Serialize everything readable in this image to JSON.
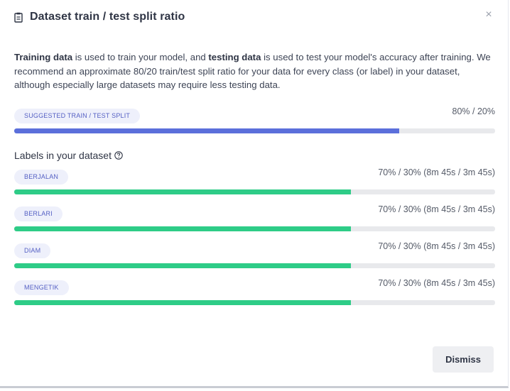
{
  "dialog": {
    "title": "Dataset train / test split ratio",
    "close_glyph": "×"
  },
  "description": {
    "part1_bold": "Training data",
    "part2": " is used to train your model, and ",
    "part3_bold": "testing data",
    "part4": " is used to test your model's accuracy after training. We recommend an approximate 80/20 train/test split ratio for your data for every class (or label) in your dataset, although especially large datasets may require less testing data."
  },
  "suggested": {
    "badge": "SUGGESTED TRAIN / TEST SPLIT",
    "ratio": "80% / 20%",
    "train_fraction": 0.8,
    "color": "#5b6fdb"
  },
  "labels_heading": "Labels in your dataset",
  "labels": [
    {
      "name": "BERJALAN",
      "ratio": "70% / 30% (8m 45s / 3m 45s)",
      "train_fraction": 0.7
    },
    {
      "name": "BERLARI",
      "ratio": "70% / 30% (8m 45s / 3m 45s)",
      "train_fraction": 0.7
    },
    {
      "name": "DIAM",
      "ratio": "70% / 30% (8m 45s / 3m 45s)",
      "train_fraction": 0.7
    },
    {
      "name": "MENGETIK",
      "ratio": "70% / 30% (8m 45s / 3m 45s)",
      "train_fraction": 0.7
    }
  ],
  "label_bar_color": "#2ecc87",
  "icons": {
    "title": "clipboard-icon",
    "help": "question-circle-icon",
    "close": "close-icon"
  },
  "dismiss_label": "Dismiss"
}
